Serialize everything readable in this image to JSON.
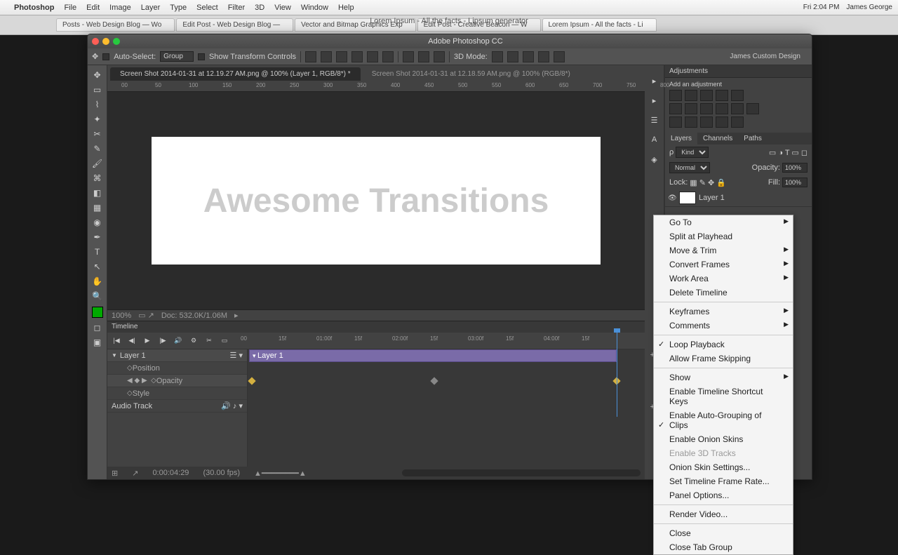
{
  "menubar": {
    "app": "Photoshop",
    "items": [
      "File",
      "Edit",
      "Image",
      "Layer",
      "Type",
      "Select",
      "Filter",
      "3D",
      "View",
      "Window",
      "Help"
    ],
    "clock": "Fri 2:04 PM",
    "user": "James George"
  },
  "browser": {
    "title": "Lorem Ipsum - All the facts - Lipsum generator",
    "tabs": [
      "Posts - Web Design Blog — Wo",
      "Edit Post - Web Design Blog —",
      "Vector and Bitmap Graphics Exp",
      "Edit Post - Creative Beacon — W",
      "Lorem Ipsum - All the facts - Li"
    ]
  },
  "ps": {
    "title": "Adobe Photoshop CC",
    "options": {
      "autoselect": "Auto-Select:",
      "group": "Group",
      "transform": "Show Transform Controls",
      "mode3d": "3D Mode:",
      "workspace": "James Custom Design"
    },
    "docs": [
      {
        "name": "Screen Shot 2014-01-31 at 12.19.27 AM.png @ 100% (Layer 1, RGB/8*) *",
        "active": true
      },
      {
        "name": "Screen Shot 2014-01-31 at 12.18.59 AM.png @ 100% (RGB/8*)",
        "active": false
      }
    ],
    "ruler_marks": [
      "00",
      "50",
      "100",
      "150",
      "200",
      "250",
      "300",
      "350",
      "400",
      "450",
      "500",
      "550",
      "600",
      "650",
      "700",
      "750",
      "800"
    ],
    "canvas_text": "Awesome Transitions",
    "zoom": "100%",
    "docsize": "Doc: 532.0K/1.06M"
  },
  "timeline": {
    "header": "Timeline",
    "marks": [
      "00",
      "15f",
      "01:00f",
      "15f",
      "02:00f",
      "15f",
      "03:00f",
      "15f",
      "04:00f",
      "15f"
    ],
    "layer": "Layer 1",
    "props": [
      "Position",
      "Opacity",
      "Style"
    ],
    "audio": "Audio Track",
    "time": "0:00:04:29",
    "fps": "(30.00 fps)"
  },
  "panels": {
    "adjustments": "Adjustments",
    "addadj": "Add an adjustment",
    "layers_tabs": [
      "Layers",
      "Channels",
      "Paths"
    ],
    "kind": "Kind",
    "blend": "Normal",
    "opacity_lbl": "Opacity:",
    "opacity": "100%",
    "lock": "Lock:",
    "fill_lbl": "Fill:",
    "fill": "100%",
    "layer1": "Layer 1"
  },
  "ctx": {
    "items1": [
      {
        "t": "Go To",
        "sub": true
      },
      {
        "t": "Split at Playhead"
      },
      {
        "t": "Move & Trim",
        "sub": true
      },
      {
        "t": "Convert Frames",
        "sub": true
      },
      {
        "t": "Work Area",
        "sub": true
      },
      {
        "t": "Delete Timeline"
      }
    ],
    "items2": [
      {
        "t": "Keyframes",
        "sub": true
      },
      {
        "t": "Comments",
        "sub": true
      }
    ],
    "items3": [
      {
        "t": "Loop Playback",
        "chk": true
      },
      {
        "t": "Allow Frame Skipping"
      }
    ],
    "items4": [
      {
        "t": "Show",
        "sub": true
      },
      {
        "t": "Enable Timeline Shortcut Keys"
      },
      {
        "t": "Enable Auto-Grouping of Clips",
        "chk": true
      },
      {
        "t": "Enable Onion Skins"
      },
      {
        "t": "Enable 3D Tracks",
        "disabled": true
      },
      {
        "t": "Onion Skin Settings..."
      },
      {
        "t": "Set Timeline Frame Rate..."
      },
      {
        "t": "Panel Options..."
      }
    ],
    "items5": [
      {
        "t": "Render Video..."
      }
    ],
    "items6": [
      {
        "t": "Close"
      },
      {
        "t": "Close Tab Group"
      }
    ]
  }
}
